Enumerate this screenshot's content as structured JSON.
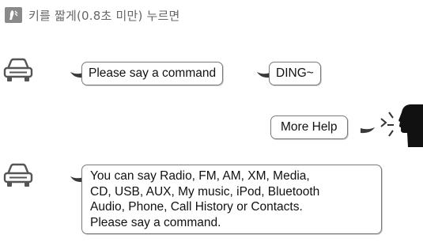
{
  "instruction": {
    "icon": "talk-key-icon",
    "text": "키를 짧게(0.8초 미만) 누르면"
  },
  "dialog": {
    "system_prompt_1": "Please say a command",
    "beep": "DING~",
    "user_command": "More Help",
    "system_response_lines": [
      "You can say Radio, FM, AM, XM, Media,",
      "CD, USB, AUX, My music, iPod, Bluetooth",
      "Audio, Phone, Call History or Contacts.",
      "Please say a command."
    ]
  },
  "icons": {
    "car": "car-icon",
    "speaker": "speaking-person-icon"
  },
  "colors": {
    "bubble_border": "#7a7a7a",
    "icon_gray": "#8a8a8a",
    "tail": "#3a3a3a"
  }
}
